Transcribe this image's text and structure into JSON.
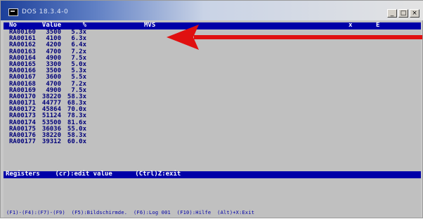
{
  "window": {
    "title": "DOS 18.3.4-0",
    "minimize": "_",
    "maximize": "□",
    "close": "×"
  },
  "header": {
    "no": "No",
    "value": "Value",
    "pct": "%",
    "mid": "MVS",
    "x2": "x",
    "e": "E"
  },
  "rows": [
    {
      "no": "RA00160",
      "value": "3500",
      "pct": "5.3x"
    },
    {
      "no": "RA00161",
      "value": "4100",
      "pct": "6.3x"
    },
    {
      "no": "RA00162",
      "value": "4200",
      "pct": "6.4x"
    },
    {
      "no": "RA00163",
      "value": "4700",
      "pct": "7.2x"
    },
    {
      "no": "RA00164",
      "value": "4900",
      "pct": "7.5x"
    },
    {
      "no": "RA00165",
      "value": "3300",
      "pct": "5.0x"
    },
    {
      "no": "RA00166",
      "value": "3500",
      "pct": "5.3x"
    },
    {
      "no": "RA00167",
      "value": "3600",
      "pct": "5.5x"
    },
    {
      "no": "RA00168",
      "value": "4700",
      "pct": "7.2x"
    },
    {
      "no": "RA00169",
      "value": "4900",
      "pct": "7.5x"
    },
    {
      "no": "RA00170",
      "value": "38220",
      "pct": "58.3x"
    },
    {
      "no": "RA00171",
      "value": "44777",
      "pct": "68.3x"
    },
    {
      "no": "RA00172",
      "value": "45864",
      "pct": "70.0x"
    },
    {
      "no": "RA00173",
      "value": "51124",
      "pct": "78.3x"
    },
    {
      "no": "RA00174",
      "value": "53500",
      "pct": "81.6x"
    },
    {
      "no": "RA00175",
      "value": "36036",
      "pct": "55.0x"
    },
    {
      "no": "RA00176",
      "value": "38220",
      "pct": "58.3x"
    },
    {
      "no": "RA00177",
      "value": "39312",
      "pct": "60.0x"
    }
  ],
  "status": {
    "label": "Registers",
    "edit_hint": "(cr):edit value",
    "exit_hint": "(Ctrl)Z:exit"
  },
  "function_keys": "(F1)-(F4):(F7)-(F9)  (F5):Bildschirmde.  (F6):Log 001  (F10):Hilfe  (Alt)+X:Exit",
  "colors": {
    "console_bg": "#c0c0c0",
    "header_bg": "#0000a8",
    "row_text": "#00007a",
    "arrow": "#e01010"
  },
  "annotation": {
    "icon": "red-arrow-icon"
  }
}
